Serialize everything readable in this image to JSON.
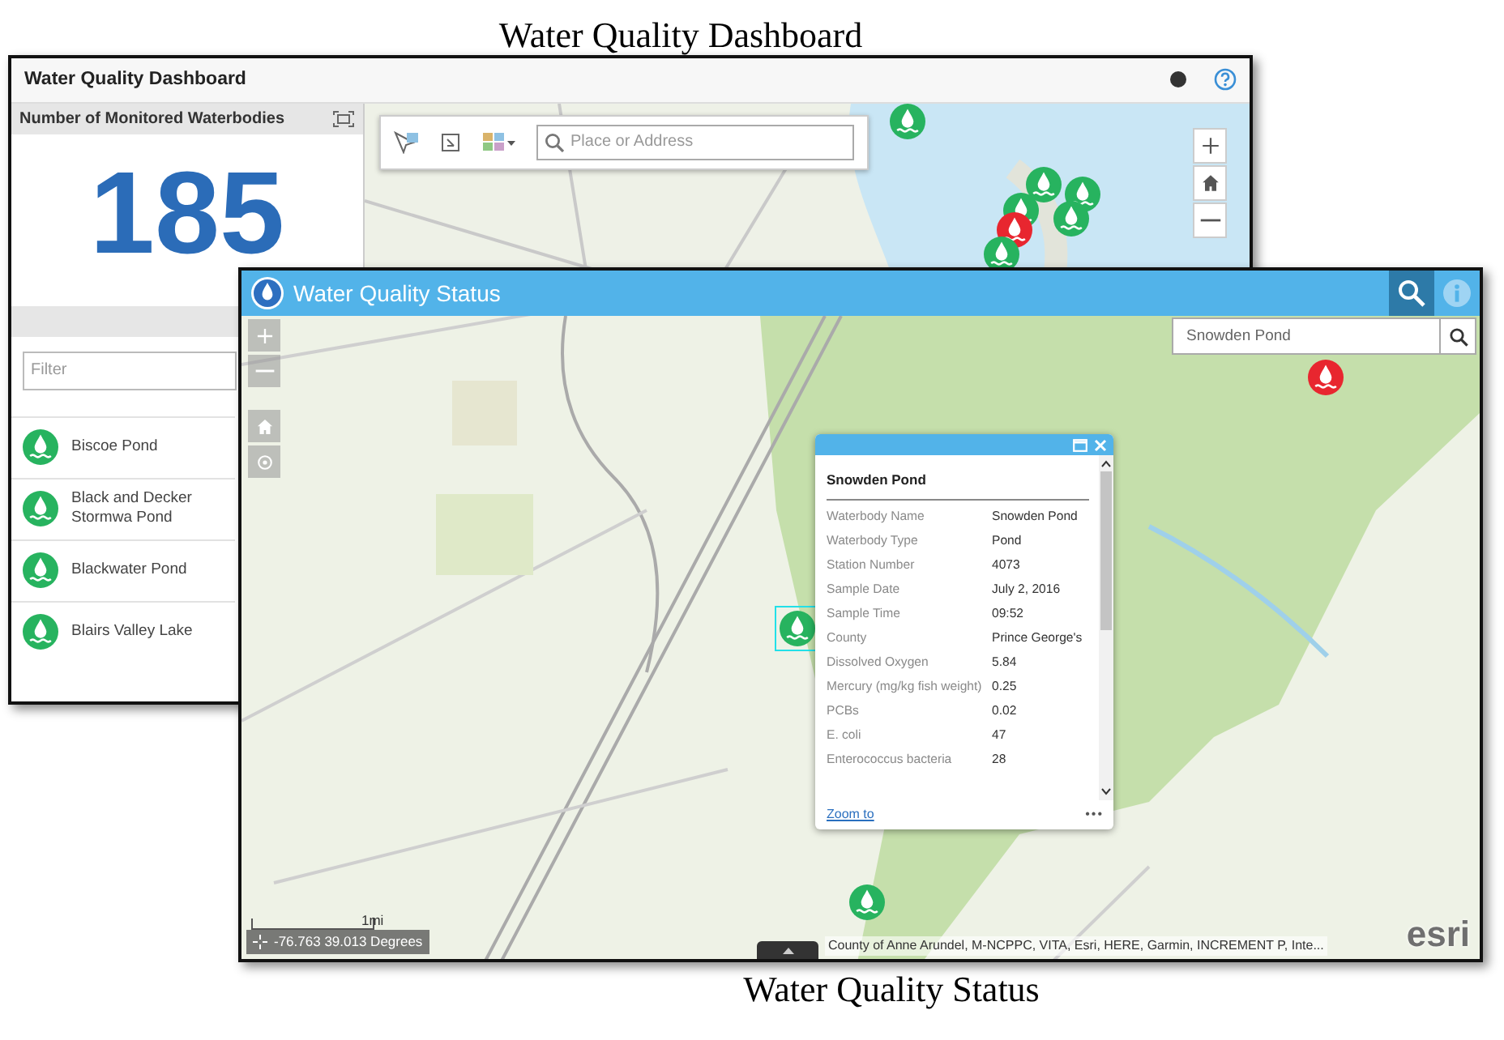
{
  "dashboard_caption": "Water Quality Dashboard",
  "dashboard": {
    "title": "Water Quality Dashboard",
    "indicator": {
      "title": "Number of Monitored Waterbodies",
      "value": "185"
    },
    "list": {
      "filter_placeholder": "Filter",
      "items": [
        {
          "name": "Biscoe Pond"
        },
        {
          "name": "Black and Decker Stormwa Pond"
        },
        {
          "name": "Blackwater Pond"
        },
        {
          "name": "Blairs Valley Lake"
        }
      ]
    },
    "map": {
      "search_placeholder": "Place or Address",
      "markers": [
        {
          "color": "#27b35f"
        },
        {
          "color": "#27b35f"
        },
        {
          "color": "#27b35f"
        },
        {
          "color": "#27b35f"
        },
        {
          "color": "#27b35f"
        },
        {
          "color": "#e8262f"
        },
        {
          "color": "#27b35f"
        }
      ]
    }
  },
  "status": {
    "title": "Water Quality Status",
    "search": {
      "value": "Snowden Pond"
    },
    "markers": [
      {
        "color": "#e8262f",
        "selected": false
      },
      {
        "color": "#27b35f",
        "selected": true
      },
      {
        "color": "#27b35f",
        "selected": false
      }
    ],
    "popup": {
      "title": "Snowden Pond",
      "fields": [
        {
          "label": "Waterbody Name",
          "value": "Snowden Pond"
        },
        {
          "label": "Waterbody Type",
          "value": "Pond"
        },
        {
          "label": "Station Number",
          "value": "4073"
        },
        {
          "label": "Sample Date",
          "value": "July 2, 2016"
        },
        {
          "label": "Sample Time",
          "value": "09:52"
        },
        {
          "label": "County",
          "value": "Prince George's"
        },
        {
          "label": "Dissolved Oxygen",
          "value": "5.84"
        },
        {
          "label": "Mercury (mg/kg fish weight)",
          "value": "0.25"
        },
        {
          "label": "PCBs",
          "value": "0.02"
        },
        {
          "label": "E. coli",
          "value": "47"
        },
        {
          "label": "Enterococcus bacteria",
          "value": "28"
        }
      ],
      "link": "Zoom to",
      "more": "•••"
    },
    "scale": "1mi",
    "coordinates": "-76.763 39.013 Degrees",
    "attribution": "County of Anne Arundel, M-NCPPC, VITA, Esri, HERE, Garmin, INCREMENT P, Inte...",
    "logo": "esri"
  },
  "status_caption": "Water Quality Status"
}
